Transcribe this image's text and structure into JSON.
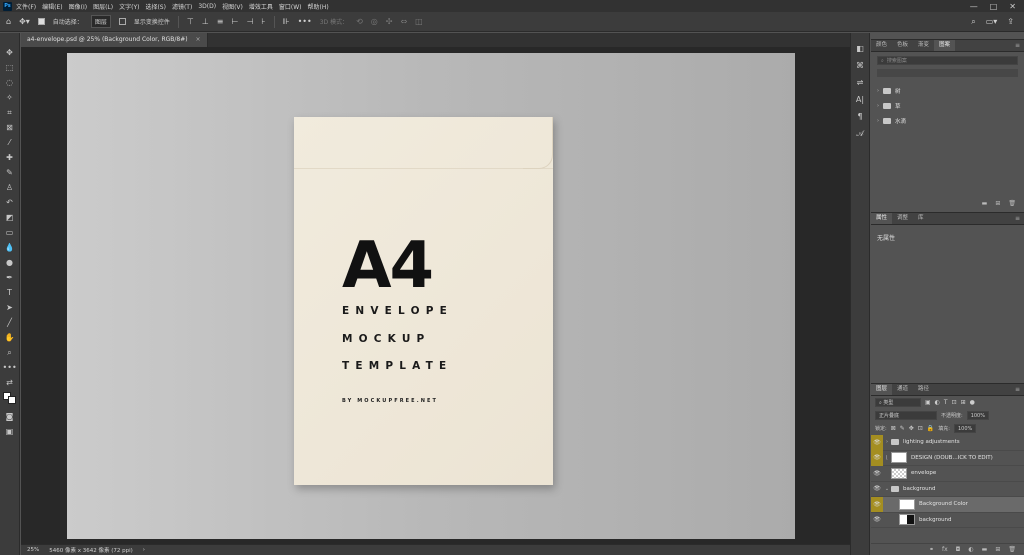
{
  "app": {
    "logo": "Ps"
  },
  "menu": [
    "文件(F)",
    "编辑(E)",
    "图像(I)",
    "图层(L)",
    "文字(Y)",
    "选择(S)",
    "滤镜(T)",
    "3D(D)",
    "视图(V)",
    "增效工具",
    "窗口(W)",
    "帮助(H)"
  ],
  "window_controls": {
    "minimize": "—",
    "maximize": "□",
    "close": "✕"
  },
  "options": {
    "auto_select_label": "自动选择：",
    "auto_select_value": "图层",
    "show_transform_label": "显示变换控件",
    "mode_label": "3D 模式："
  },
  "document": {
    "tab_title": "a4-envelope.psd @ 25% (Background Color, RGB/8#)",
    "close": "×"
  },
  "envelope_art": {
    "title": "A4",
    "line1": "ENVELOPE",
    "line2": "MOCKUP",
    "line3": "TEMPLATE",
    "byline": "BY MOCKUPFREE.NET"
  },
  "status": {
    "zoom": "25%",
    "size": "5460 像素 x 3642 像素 (72 ppi)",
    "arrow": "›"
  },
  "libraries_panel": {
    "tabs": [
      "颜色",
      "色板",
      "渐变",
      "图案"
    ],
    "active_tab": 3,
    "search_placeholder": "搜索图案",
    "groups": [
      "树",
      "草",
      "水滴"
    ]
  },
  "properties_panel": {
    "tabs": [
      "属性",
      "调整",
      "库"
    ],
    "active_tab": 0,
    "empty_text": "无属性"
  },
  "layers_panel": {
    "tabs": [
      "图层",
      "通道",
      "路径"
    ],
    "active_tab": 0,
    "filter_label": "类型",
    "blend_mode": "正片叠底",
    "opacity_label": "不透明度:",
    "opacity_value": "100%",
    "lock_label": "锁定:",
    "fill_label": "填充:",
    "fill_value": "100%",
    "layers": [
      {
        "name": "lighting adjustments",
        "type": "group",
        "eye_highlight": true,
        "indent": 0
      },
      {
        "name": "DESIGN (DOUB...ICK TO EDIT)",
        "type": "smart",
        "eye_highlight": true,
        "indent": 0
      },
      {
        "name": "envelope",
        "type": "checker",
        "eye_highlight": false,
        "indent": 0
      },
      {
        "name": "background",
        "type": "group-open",
        "eye_highlight": false,
        "indent": 0
      },
      {
        "name": "Background Color",
        "type": "fill",
        "eye_highlight": true,
        "indent": 1,
        "selected": true
      },
      {
        "name": "background",
        "type": "black",
        "eye_highlight": false,
        "indent": 1
      }
    ]
  }
}
